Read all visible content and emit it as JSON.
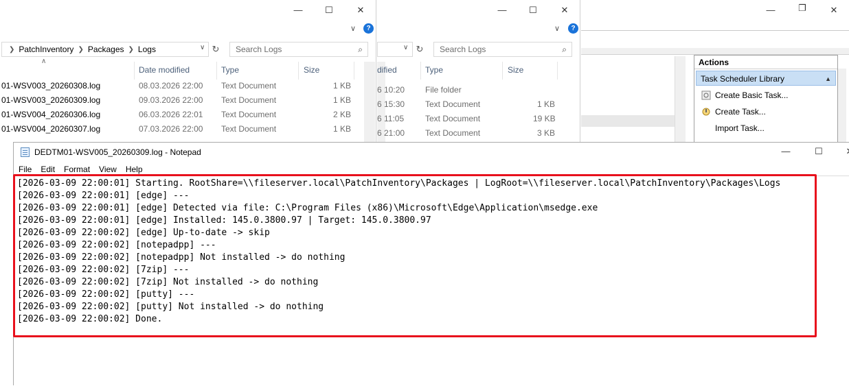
{
  "explorer1": {
    "path": [
      "PatchInventory",
      "Packages",
      "Logs"
    ],
    "search_placeholder": "Search Logs",
    "columns": {
      "date": "Date modified",
      "type": "Type",
      "size": "Size"
    },
    "rows": [
      {
        "name": "01-WSV003_20260308.log",
        "date": "08.03.2026 22:00",
        "type": "Text Document",
        "size": "1 KB"
      },
      {
        "name": "01-WSV003_20260309.log",
        "date": "09.03.2026 22:00",
        "type": "Text Document",
        "size": "1 KB"
      },
      {
        "name": "01-WSV004_20260306.log",
        "date": "06.03.2026 22:01",
        "type": "Text Document",
        "size": "2 KB"
      },
      {
        "name": "01-WSV004_20260307.log",
        "date": "07.03.2026 22:00",
        "type": "Text Document",
        "size": "1 KB"
      }
    ]
  },
  "explorer2": {
    "search_placeholder": "Search Logs",
    "columns": {
      "date": "dified",
      "type": "Type",
      "size": "Size"
    },
    "rows": [
      {
        "date": "6 10:20",
        "type": "File folder",
        "size": ""
      },
      {
        "date": "6 15:30",
        "type": "Text Document",
        "size": "1 KB"
      },
      {
        "date": "6 11:05",
        "type": "Text Document",
        "size": "19 KB"
      },
      {
        "date": "6 21:00",
        "type": "Text Document",
        "size": "3 KB"
      }
    ]
  },
  "task_scheduler": {
    "actions_header": "Actions",
    "library_label": "Task Scheduler Library",
    "items": [
      "Create Basic Task...",
      "Create Task...",
      "Import Task..."
    ]
  },
  "notepad": {
    "title": "DEDTM01-WSV005_20260309.log - Notepad",
    "menu": [
      "File",
      "Edit",
      "Format",
      "View",
      "Help"
    ],
    "content": "[2026-03-09 22:00:01] Starting. RootShare=\\\\fileserver.local\\PatchInventory\\Packages | LogRoot=\\\\fileserver.local\\PatchInventory\\Packages\\Logs\n[2026-03-09 22:00:01] [edge] ---\n[2026-03-09 22:00:01] [edge] Detected via file: C:\\Program Files (x86)\\Microsoft\\Edge\\Application\\msedge.exe\n[2026-03-09 22:00:01] [edge] Installed: 145.0.3800.97 | Target: 145.0.3800.97\n[2026-03-09 22:00:02] [edge] Up-to-date -> skip\n[2026-03-09 22:00:02] [notepadpp] ---\n[2026-03-09 22:00:02] [notepadpp] Not installed -> do nothing\n[2026-03-09 22:00:02] [7zip] ---\n[2026-03-09 22:00:02] [7zip] Not installed -> do nothing\n[2026-03-09 22:00:02] [putty] ---\n[2026-03-09 22:00:02] [putty] Not installed -> do nothing\n[2026-03-09 22:00:02] Done."
  },
  "icons": {
    "minimize": "minimize-icon",
    "maximize": "maximize-icon",
    "close": "close-icon",
    "help": "help-icon",
    "search": "search-icon",
    "refresh": "refresh-icon"
  },
  "colors": {
    "highlight": "#e8101c",
    "selection": "#c9dff5"
  }
}
